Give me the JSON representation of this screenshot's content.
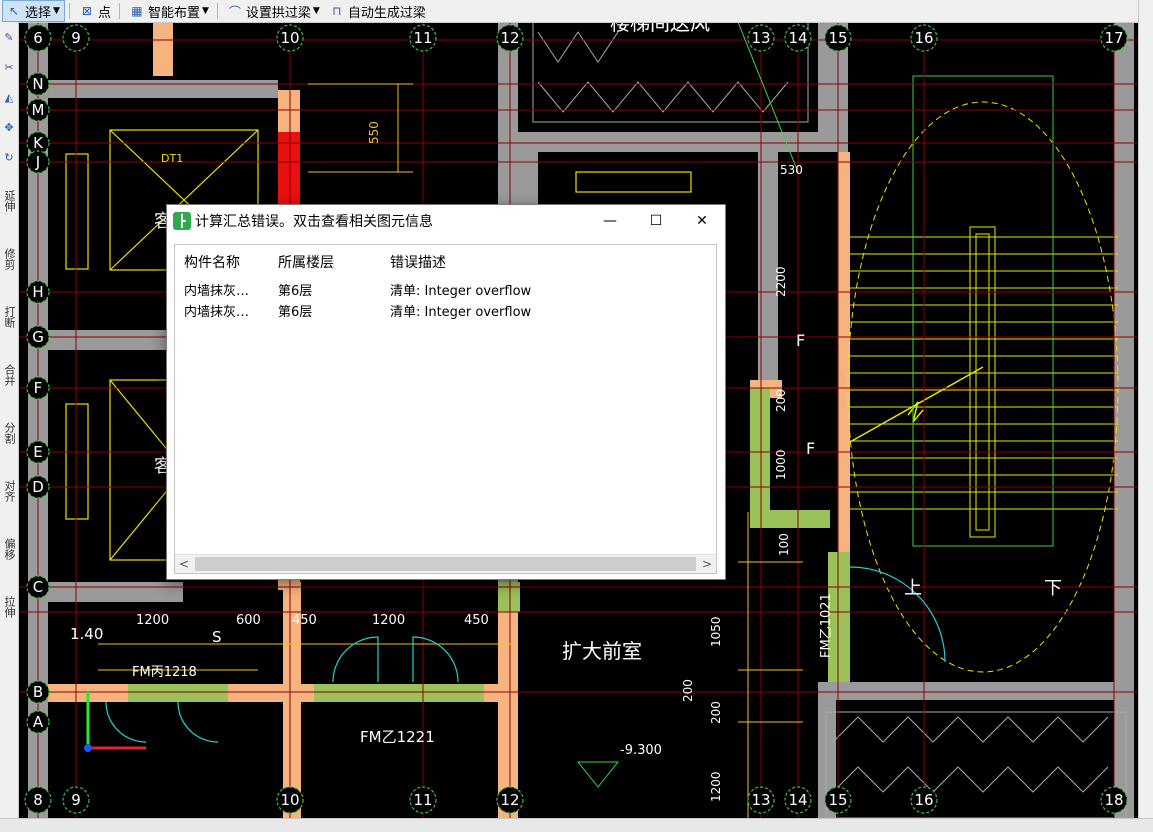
{
  "toolbar": {
    "select_label": "选择",
    "point_label": "点",
    "smart_layout_label": "智能布置",
    "arch_lintel_label": "设置拱过梁",
    "auto_lintel_label": "自动生成过梁"
  },
  "leftbar": {
    "items": [
      "延伸",
      "修剪",
      "打断",
      "合并",
      "分割",
      "对齐",
      "偏移",
      "拉伸"
    ]
  },
  "dialog": {
    "title": "计算汇总错误。双击查看相关图元信息",
    "minimize_glyph": "—",
    "maximize_glyph": "☐",
    "close_glyph": "✕",
    "columns": [
      "构件名称",
      "所属楼层",
      "错误描述"
    ],
    "rows": [
      {
        "name": "内墙抹灰…",
        "floor": "第6层",
        "desc": "清单: Integer overflow"
      },
      {
        "name": "内墙抹灰…",
        "floor": "第6层",
        "desc": "清单: Integer overflow"
      }
    ]
  },
  "drawing": {
    "grid_top": [
      "6",
      "9",
      "10",
      "11",
      "12",
      "13",
      "14",
      "15",
      "16",
      "17"
    ],
    "grid_bottom": [
      "8",
      "9",
      "10",
      "11",
      "12",
      "13",
      "14",
      "15",
      "16",
      "18"
    ],
    "grid_left": [
      "N",
      "M",
      "K",
      "J",
      "H",
      "G",
      "F",
      "E",
      "D",
      "C",
      "B",
      "A"
    ],
    "labels": {
      "dt1": "DT1",
      "dim_550": "550",
      "dim_530": "530",
      "dim_2200": "2200",
      "dim_200a": "200",
      "dim_1000": "1000",
      "dim_100": "100",
      "dim_1050": "1050",
      "dim_200b": "200",
      "dim_200c": "200",
      "dim_1200v": "1200",
      "dim_1200a": "1200",
      "dim_600": "600",
      "dim_450a": "450",
      "dim_1200b": "1200",
      "dim_450b": "450",
      "level_140": "1.40",
      "fm_bing": "FM丙1218",
      "fm_yi": "FM乙1221",
      "fm_yi_v": "FM乙1021",
      "front_room": "扩大前室",
      "elev": "-9.300",
      "up": "上",
      "down": "下",
      "stair_note": "楼梯间送风",
      "f1": "F",
      "f2": "F",
      "s": "S",
      "ke": "客",
      "ke2": "客"
    }
  },
  "colors": {
    "canvas_bg": "#000000",
    "wall_gray": "#9a9a9a",
    "column_orange": "#f5b37f",
    "green_wall": "#9bc25a",
    "dim_yellow": "#f0c020",
    "stair_yellow": "#e8e800",
    "red_axis": "#8b0000",
    "grid_green": "#3fbf3f",
    "cyan": "#20d0d0"
  }
}
